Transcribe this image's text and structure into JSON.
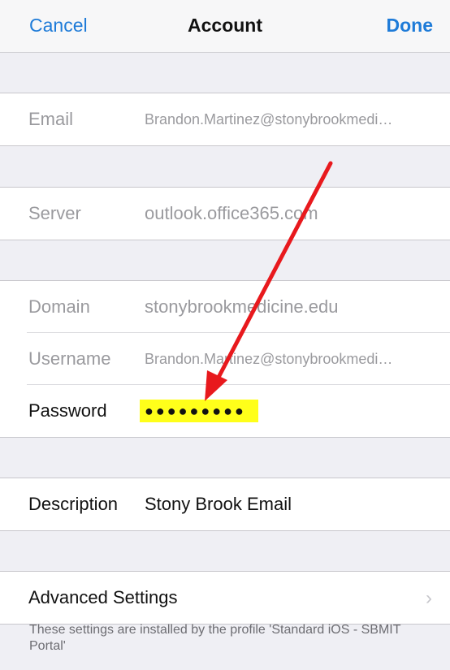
{
  "navbar": {
    "cancel_label": "Cancel",
    "title": "Account",
    "done_label": "Done"
  },
  "email_group": {
    "label": "Email",
    "value": "Brandon.Martinez@stonybrookmedi…"
  },
  "server_group": {
    "label": "Server",
    "value": "outlook.office365.com"
  },
  "credentials_group": {
    "domain_label": "Domain",
    "domain_value": "stonybrookmedicine.edu",
    "username_label": "Username",
    "username_value": "Brandon.Martinez@stonybrookmedi…",
    "password_label": "Password",
    "password_value": "●●●●●●●●●"
  },
  "description_group": {
    "label": "Description",
    "value": "Stony Brook Email"
  },
  "advanced_group": {
    "label": "Advanced Settings",
    "chevron_icon": "chevron-right-icon"
  },
  "footer": {
    "text": "These settings are installed by the profile 'Standard iOS - SBMIT Portal'"
  },
  "annotation": {
    "arrow_color": "#e8191d",
    "highlight_color": "#ffff1a"
  }
}
